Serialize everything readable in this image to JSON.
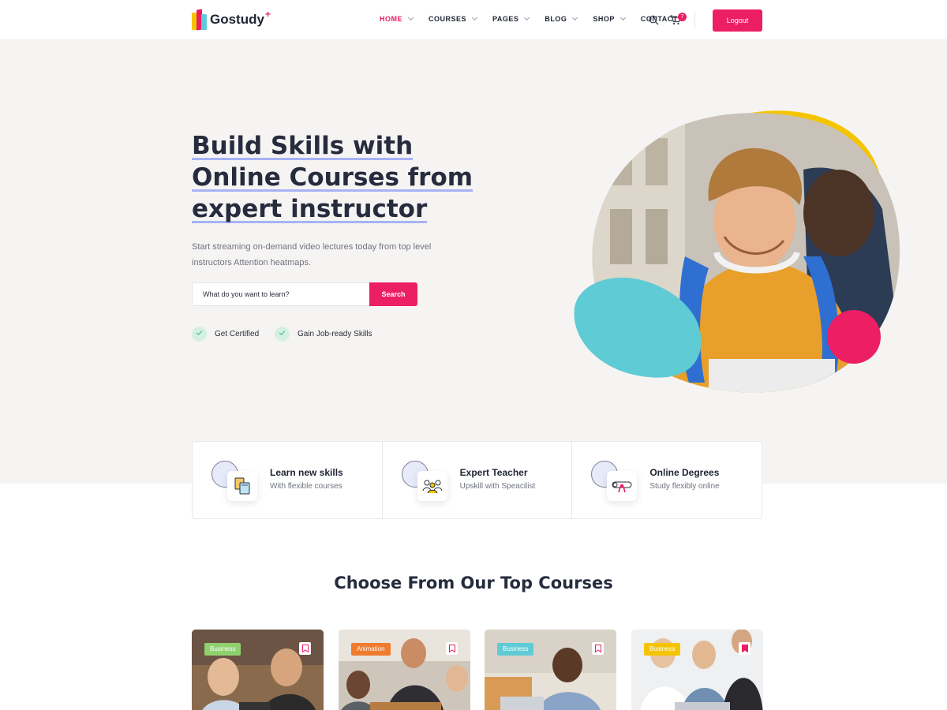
{
  "brand": {
    "name": "Gostudy",
    "plus": "+",
    "colors": {
      "primary": "#ec1e64",
      "yellow": "#f5c400",
      "teal": "#5fcbd4",
      "text": "#262b3d"
    }
  },
  "nav": {
    "items": [
      {
        "label": "HOME",
        "dropdown": true,
        "active": true
      },
      {
        "label": "COURSES",
        "dropdown": true
      },
      {
        "label": "PAGES",
        "dropdown": true
      },
      {
        "label": "BLOG",
        "dropdown": true
      },
      {
        "label": "SHOP",
        "dropdown": true
      },
      {
        "label": "CONTACT",
        "dropdown": false
      }
    ],
    "cart_count": "7",
    "logout_label": "Logout"
  },
  "hero": {
    "title_lines": [
      "Build Skills with",
      "Online Courses from",
      "expert instructor"
    ],
    "subtitle": "Start streaming on-demand video lectures today from top level instructors Attention heatmaps.",
    "search_placeholder": "What do you want to learn?",
    "search_button": "Search",
    "checks": [
      "Get Certified",
      "Gain Job-ready Skills"
    ]
  },
  "features": [
    {
      "title": "Learn new skills",
      "subtitle": "With flexible courses",
      "icon": "books-icon"
    },
    {
      "title": "Expert Teacher",
      "subtitle": "Upskill with Speacilist",
      "icon": "teachers-icon"
    },
    {
      "title": "Online Degrees",
      "subtitle": "Study flexibly online",
      "icon": "diploma-icon"
    }
  ],
  "courses_section": {
    "title": "Choose From Our Top Courses",
    "cards": [
      {
        "tag": "Business",
        "tag_color": "#8fd06f",
        "bookmarked": false
      },
      {
        "tag": "Animation",
        "tag_color": "#f07b2f",
        "bookmarked": false
      },
      {
        "tag": "Business",
        "tag_color": "#5fcbd4",
        "bookmarked": false
      },
      {
        "tag": "Business",
        "tag_color": "#f5c400",
        "bookmarked": true
      }
    ]
  }
}
